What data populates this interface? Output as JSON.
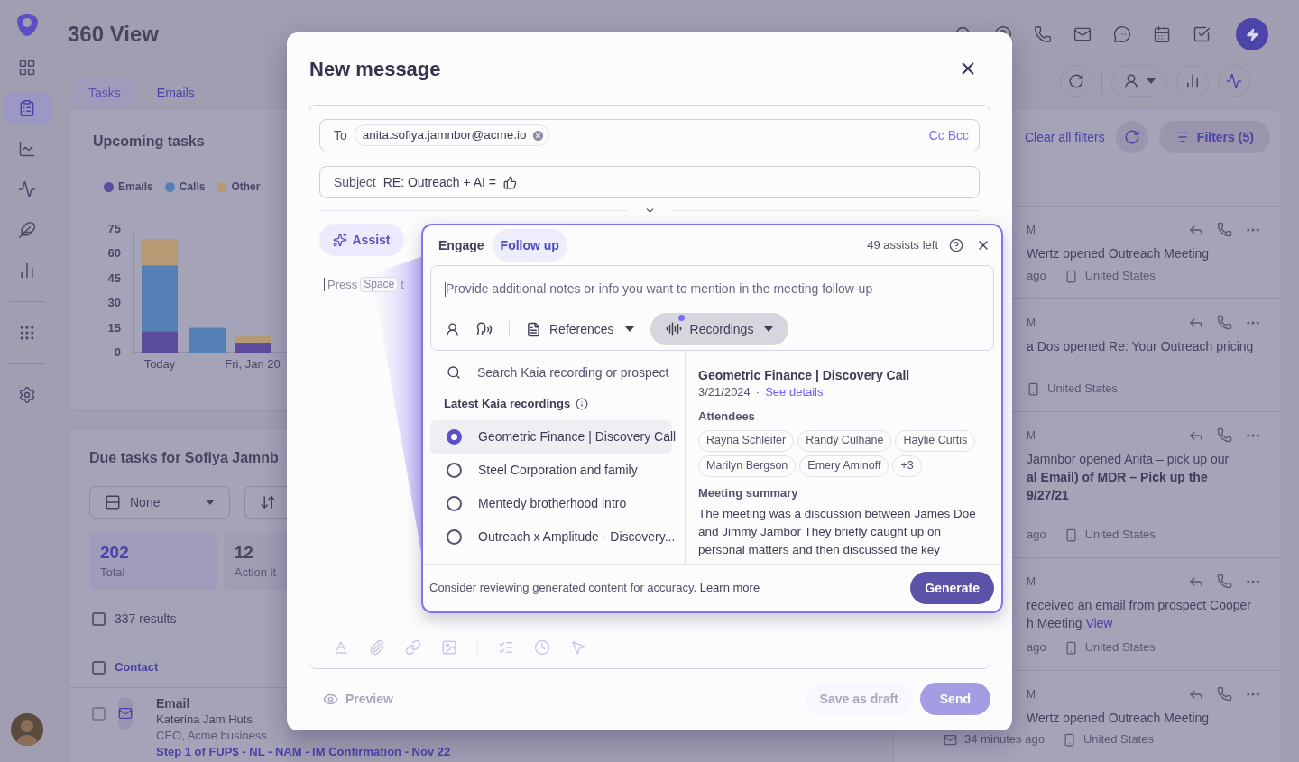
{
  "nav": {
    "items": [
      {
        "selected": false
      },
      {
        "selected": true
      },
      {
        "selected": false
      },
      {
        "selected": false
      },
      {
        "selected": false
      },
      {
        "selected": false
      },
      {
        "selected": false
      },
      {
        "selected": false
      }
    ]
  },
  "header": {
    "title": "360 View"
  },
  "tabs": [
    {
      "label": "Tasks",
      "selected": true
    },
    {
      "label": "Emails",
      "selected": false
    }
  ],
  "upcoming": {
    "title": "Upcoming tasks",
    "chart_data": {
      "type": "bar",
      "stacked": true,
      "categories": [
        "Today",
        null,
        "Fri, Jan 20"
      ],
      "ylim": [
        0,
        75
      ],
      "yticks": [
        0,
        15,
        30,
        45,
        60,
        75
      ],
      "series": [
        {
          "name": "Emails",
          "color": "#5b4d9c",
          "values": [
            13,
            0,
            6
          ]
        },
        {
          "name": "Calls",
          "color": "#5580b5",
          "values": [
            40,
            15,
            0
          ]
        },
        {
          "name": "Other",
          "color": "#b59a74",
          "values": [
            16,
            0,
            4
          ]
        }
      ]
    }
  },
  "due": {
    "title": "Due tasks for Sofiya Jamnb",
    "group_value": "None",
    "stats": [
      {
        "value": "202",
        "label": "Total",
        "selected": true
      },
      {
        "value": "12",
        "label": "Action it",
        "selected": false
      }
    ],
    "results": {
      "label": "337 results",
      "checked": false
    },
    "column": {
      "label": "Contact",
      "checked": false
    },
    "row": {
      "checked": false,
      "type": "Email",
      "name": "Katerina Jam Huts",
      "role": "CEO, Acme business",
      "step": "Step 1 of FUP$ - NL - NAM - IM Confirmation - Nov 22"
    }
  },
  "activity": {
    "clear_filters": "Clear all filters",
    "filters": "Filters (5)",
    "rows": [
      {
        "time": "M",
        "lines": [
          {
            "text": "Wertz opened Outreach Meeting",
            "bold": false
          }
        ],
        "ago": "ago",
        "location": "United States"
      },
      {
        "time": "M",
        "lines": [
          {
            "text": "a Dos opened Re: Your Outreach pricing",
            "bold": false
          }
        ],
        "location": "United States"
      },
      {
        "time": "M",
        "lines": [
          {
            "text": "Jamnbor opened Anita – pick up our",
            "bold": false
          },
          {
            "text": "al Email) of MDR – Pick up the",
            "bold": true
          },
          {
            "text": "9/27/21",
            "bold": true
          }
        ],
        "ago": "ago",
        "location": "United States"
      },
      {
        "time": "M",
        "lines": [
          {
            "text": "received an email from prospect Cooper",
            "bold": false
          },
          {
            "text": "h Meeting",
            "bold": false,
            "link": "View"
          }
        ],
        "ago": "ago",
        "location": "United States"
      },
      {
        "time": "M",
        "lines": [
          {
            "text": "Wertz opened Outreach Meeting",
            "bold": false
          }
        ],
        "ago": "34 minutes ago",
        "location": "United States"
      }
    ]
  },
  "modal": {
    "title": "New message",
    "to": {
      "label": "To",
      "recipient": "anita.sofiya.jamnbor@acme.io",
      "cc_bcc": "Cc Bcc"
    },
    "subject": {
      "label": "Subject",
      "value": "RE: Outreach + AI ="
    },
    "assist": {
      "label": "Assist",
      "hint": {
        "before": "Press",
        "key": "Space",
        "after": "t"
      }
    },
    "panel": {
      "tabs": [
        {
          "label": "Engage",
          "selected": false
        },
        {
          "label": "Follow up",
          "selected": true
        }
      ],
      "assists_left": "49 assists left",
      "notes_placeholder": "Provide additional notes or info you want to mention in the meeting follow-up",
      "sources": [
        {
          "label": "References",
          "selected": false,
          "unread": false
        },
        {
          "label": "Recordings",
          "selected": true,
          "unread": true
        }
      ],
      "search_placeholder": "Search Kaia recording or prospect",
      "list_title": "Latest Kaia recordings",
      "recordings": [
        {
          "label": "Geometric Finance | Discovery Call",
          "selected": true
        },
        {
          "label": "Steel Corporation and family",
          "selected": false
        },
        {
          "label": "Mentedy brotherhood intro",
          "selected": false
        },
        {
          "label": "Outreach x Amplitude - Discovery...",
          "selected": false
        }
      ],
      "detail": {
        "title": "Geometric Finance | Discovery Call",
        "date": "3/21/2024",
        "separator": "·",
        "see_details": "See details",
        "attendees_label": "Attendees",
        "attendees": [
          "Rayna Schleifer",
          "Randy Culhane",
          "Haylie Curtis",
          "Marilyn Bergson",
          "Emery Aminoff",
          "+3"
        ],
        "summary_label": "Meeting summary",
        "summary": "The meeting was a discussion between James Doe and Jimmy Jambor They briefly caught up on personal matters and then discussed the key"
      },
      "disclaimer": "Consider reviewing generated content for accuracy.",
      "learn_more": "Learn more",
      "generate": "Generate"
    },
    "footer": {
      "preview": {
        "label": "Preview",
        "disabled": true
      },
      "save_draft": {
        "label": "Save as draft",
        "disabled": true
      },
      "send": {
        "label": "Send",
        "disabled": true
      }
    }
  }
}
